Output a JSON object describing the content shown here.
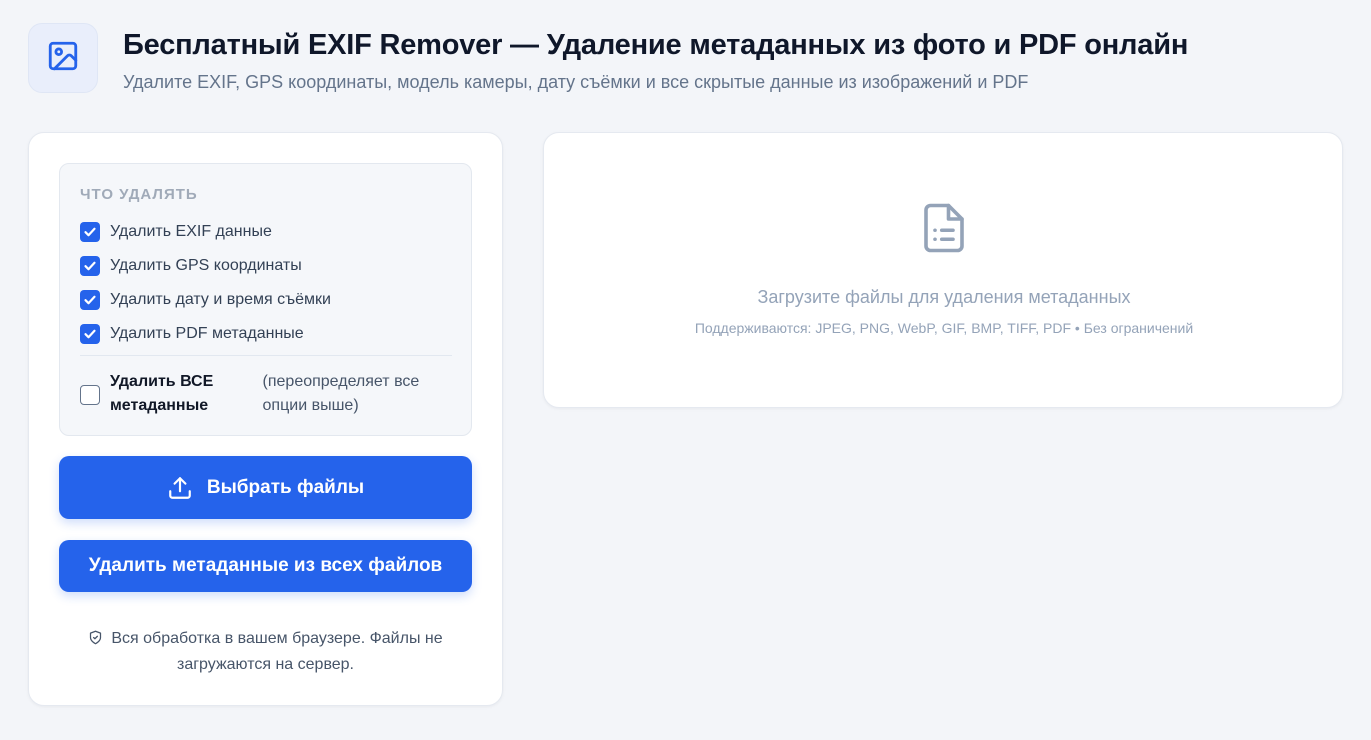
{
  "header": {
    "title": "Бесплатный EXIF Remover — Удаление метаданных из фото и PDF онлайн",
    "subtitle": "Удалите EXIF, GPS координаты, модель камеры, дату съёмки и все скрытые данные из изображений и PDF",
    "logo_icon": "image-icon"
  },
  "options": {
    "heading": "ЧТО УДАЛЯТЬ",
    "items": [
      {
        "label": "Удалить EXIF данные",
        "checked": true
      },
      {
        "label": "Удалить GPS координаты",
        "checked": true
      },
      {
        "label": "Удалить дату и время съёмки",
        "checked": true
      },
      {
        "label": "Удалить PDF метаданные",
        "checked": true
      }
    ],
    "remove_all": {
      "label": "Удалить ВСЕ метаданные",
      "note": "(переопределяет все опции выше)",
      "checked": false
    }
  },
  "buttons": {
    "choose_files": "Выбрать файлы",
    "remove_all_files": "Удалить метаданные из всех файлов"
  },
  "privacy_note": "Вся обработка в вашем браузере. Файлы не загружаются на сервер.",
  "dropzone": {
    "title": "Загрузите файлы для удаления метаданных",
    "subtitle": "Поддерживаются: JPEG, PNG, WebP, GIF, BMP, TIFF, PDF • Без ограничений",
    "icon": "document-icon"
  },
  "colors": {
    "accent": "#2563eb",
    "background": "#f3f5f9",
    "muted": "#94a3b8"
  }
}
